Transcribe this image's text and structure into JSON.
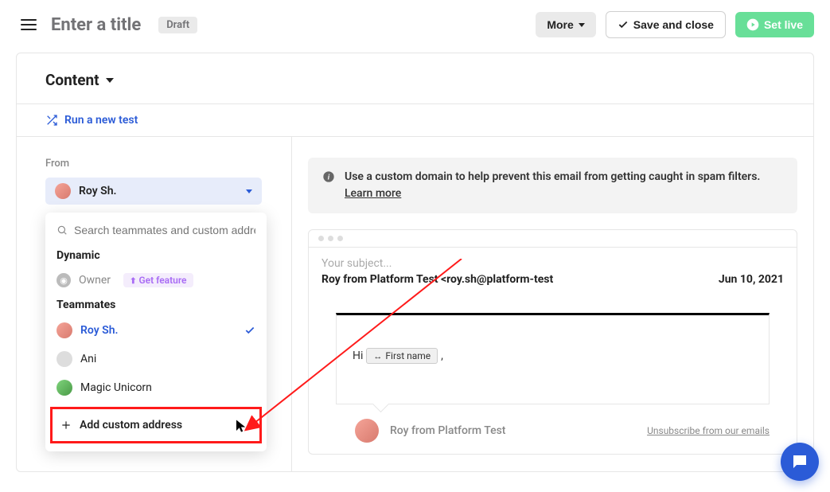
{
  "topbar": {
    "title": "Enter a title",
    "badge": "Draft",
    "more_label": "More",
    "save_label": "Save and close",
    "live_label": "Set live"
  },
  "content_header": "Content",
  "run_test": "Run a new test",
  "from": {
    "label": "From",
    "selected": "Roy Sh.",
    "search_placeholder": "Search teammates and custom addre",
    "dynamic_header": "Dynamic",
    "owner_label": "Owner",
    "get_feature": "Get feature",
    "teammates_header": "Teammates",
    "teammates": [
      {
        "name": "Roy Sh.",
        "selected": true
      },
      {
        "name": "Ani",
        "selected": false
      },
      {
        "name": "Magic Unicorn",
        "selected": false
      }
    ],
    "add_custom": "Add custom address"
  },
  "notice": {
    "text": "Use a custom domain to help prevent this email from getting caught in spam filters.",
    "link": "Learn more"
  },
  "email": {
    "subject_placeholder": "Your subject...",
    "sender": "Roy from Platform Test <roy.sh@platform-test",
    "date": "Jun 10, 2021",
    "greeting_hi": "Hi",
    "merge_tag": "First name",
    "greeting_comma": ",",
    "signer": "Roy from Platform Test",
    "unsubscribe": "Unsubscribe from our emails"
  }
}
